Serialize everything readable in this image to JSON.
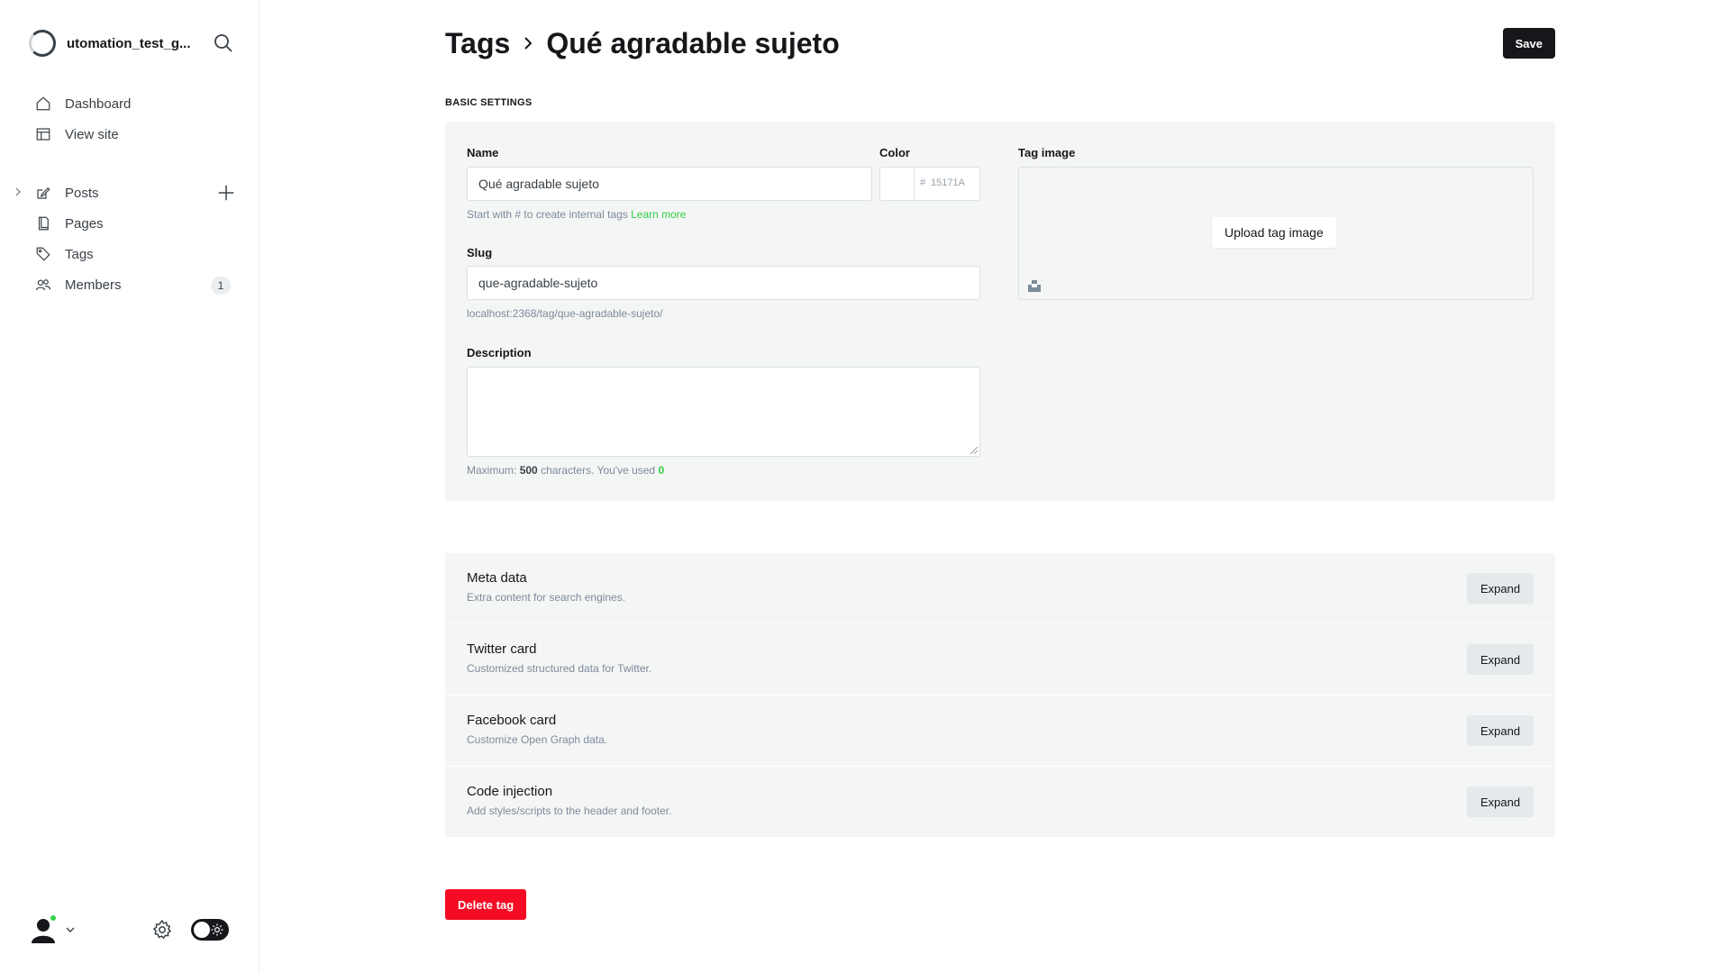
{
  "sidebar": {
    "site_name": "utomation_test_g...",
    "nav_primary": [
      {
        "label": "Dashboard",
        "icon": "home-icon"
      },
      {
        "label": "View site",
        "icon": "layout-icon"
      }
    ],
    "nav_content": [
      {
        "label": "Posts",
        "icon": "edit-icon"
      },
      {
        "label": "Pages",
        "icon": "page-icon"
      },
      {
        "label": "Tags",
        "icon": "tag-icon"
      },
      {
        "label": "Members",
        "icon": "members-icon",
        "badge": "1"
      }
    ]
  },
  "header": {
    "breadcrumb": "Tags",
    "title": "Qué agradable sujeto",
    "save_label": "Save"
  },
  "basic": {
    "section_title": "Basic settings",
    "name_label": "Name",
    "name_value": "Qué agradable sujeto",
    "name_hint": "Start with # to create internal tags",
    "learn_more": "Learn more",
    "color_label": "Color",
    "color_hash": "#",
    "color_placeholder": "15171A",
    "slug_label": "Slug",
    "slug_value": "que-agradable-sujeto",
    "slug_url": "localhost:2368/tag/que-agradable-sujeto/",
    "description_label": "Description",
    "desc_hint_prefix": "Maximum:",
    "desc_max": "500",
    "desc_hint_mid": "characters. You've used",
    "desc_used": "0",
    "tag_image_label": "Tag image",
    "upload_label": "Upload tag image"
  },
  "sections": [
    {
      "title": "Meta data",
      "desc": "Extra content for search engines.",
      "button": "Expand"
    },
    {
      "title": "Twitter card",
      "desc": "Customized structured data for Twitter.",
      "button": "Expand"
    },
    {
      "title": "Facebook card",
      "desc": "Customize Open Graph data.",
      "button": "Expand"
    },
    {
      "title": "Code injection",
      "desc": "Add styles/scripts to the header and footer.",
      "button": "Expand"
    }
  ],
  "delete_label": "Delete tag",
  "colors": {
    "accent": "#30cf43",
    "dark": "#15171a",
    "danger": "#f50b23",
    "card_bg": "#f4f5f5"
  }
}
